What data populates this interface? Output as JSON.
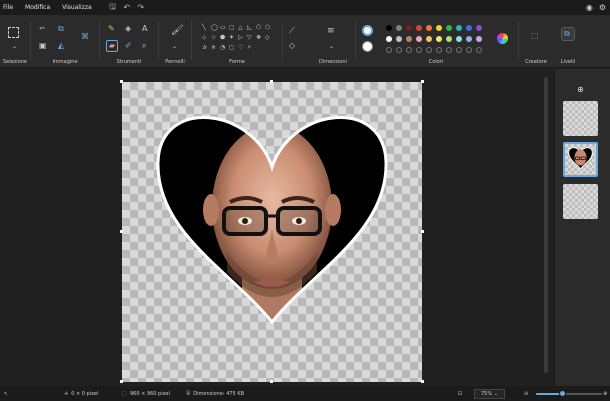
{
  "menu": {
    "file": "File",
    "edit": "Modifica",
    "view": "Visualizza"
  },
  "ribbon": {
    "groups": {
      "selection": "Selezione",
      "image": "Immagine",
      "tools": "Strumenti",
      "brushes": "Pennelli",
      "shapes": "Forme",
      "size": "Dimensioni",
      "colors": "Colori",
      "creator": "Creatore",
      "layers": "Livelli"
    },
    "colors": {
      "primary": "#ffffff",
      "secondary": "#ffffff",
      "palette_row1": [
        "#000000",
        "#808080",
        "#7b1e1e",
        "#e03c3c",
        "#f07a2a",
        "#f5d12a",
        "#35b34a",
        "#2bb3b8",
        "#3a6fe0",
        "#8e4bd8"
      ],
      "palette_row2": [
        "#ffffff",
        "#c0c0c0",
        "#b6846a",
        "#f2a2b7",
        "#f6c36b",
        "#f0e67a",
        "#b5df6e",
        "#8fe0e8",
        "#8fb3f0",
        "#c8a8e8"
      ],
      "palette_row3_count": 10
    },
    "shape_glyphs": [
      "╲",
      "◯",
      "▭",
      "▢",
      "△",
      "◺",
      "⬠",
      "⬡",
      "⬦",
      "☆",
      "⬟",
      "✦",
      "▷",
      "▽",
      "❖",
      "◇",
      "✰",
      "✯",
      "◔",
      "◻",
      "♡",
      "⚡"
    ]
  },
  "layers_panel": {
    "add_glyph": "⊕"
  },
  "status": {
    "cursor": "0 × 0 pixel",
    "selection": "",
    "image_size": "960 × 960 pixel",
    "disk_size": "Dimensione: 475 KB",
    "zoom": "75%",
    "zoom_value": 0.4
  }
}
